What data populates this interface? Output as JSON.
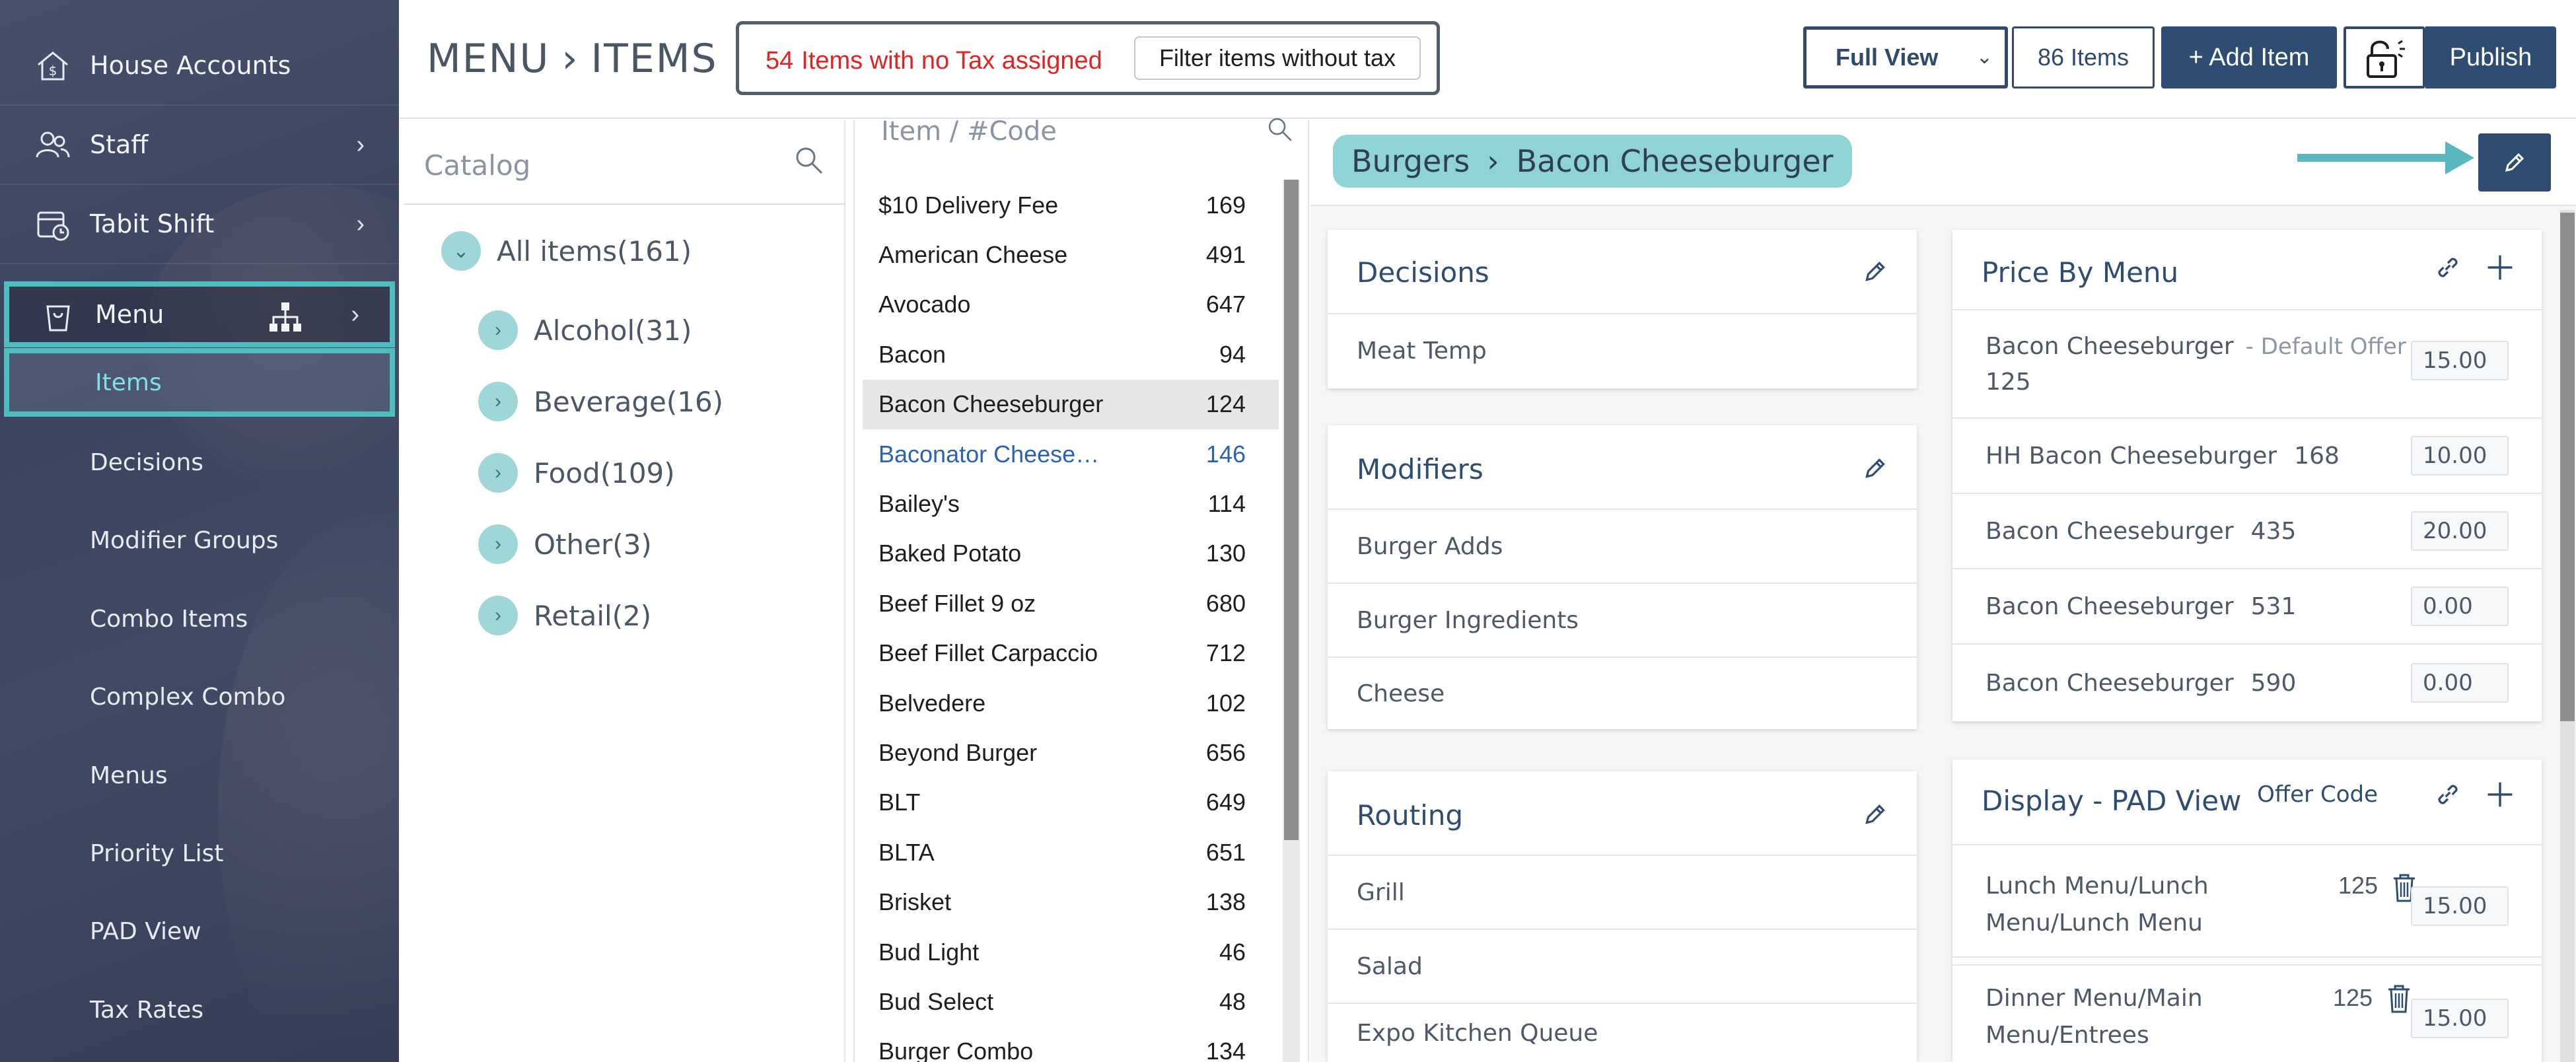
{
  "sidebar": {
    "items": [
      {
        "label": "House Accounts",
        "icon": "house-dollar-icon"
      },
      {
        "label": "Staff",
        "icon": "people-icon"
      },
      {
        "label": "Tabit Shift",
        "icon": "calendar-clock-icon"
      },
      {
        "label": "Menu",
        "icon": "menu-bag-icon"
      }
    ],
    "active_sub": "Items",
    "subitems": [
      "Decisions",
      "Modifier Groups",
      "Combo Items",
      "Complex Combo",
      "Menus",
      "Priority List",
      "PAD View",
      "Tax Rates"
    ],
    "highlight_color": "#4fbcc0"
  },
  "header": {
    "breadcrumb_root": "MENU",
    "breadcrumb_page": "ITEMS",
    "tax_alert_count": "54",
    "tax_alert_text": "Items with no Tax assigned",
    "filter_button": "Filter items without tax",
    "view_select": "Full View",
    "items_count": "86 Items",
    "add_item": "+ Add Item",
    "publish": "Publish"
  },
  "catalog": {
    "search_placeholder": "Catalog",
    "root": "All items(161)",
    "categories": [
      "Alcohol(31)",
      "Beverage(16)",
      "Food(109)",
      "Other(3)",
      "Retail(2)"
    ]
  },
  "items_list": {
    "search_placeholder": "Item / #Code",
    "rows": [
      {
        "name": "$10 Delivery Fee",
        "code": "169"
      },
      {
        "name": "American Cheese",
        "code": "491"
      },
      {
        "name": "Avocado",
        "code": "647"
      },
      {
        "name": "Bacon",
        "code": "94"
      },
      {
        "name": "Bacon Cheeseburger",
        "code": "124"
      },
      {
        "name": "Baconator Cheese…",
        "code": "146"
      },
      {
        "name": "Bailey's",
        "code": "114"
      },
      {
        "name": "Baked Potato",
        "code": "130"
      },
      {
        "name": "Beef Fillet 9 oz",
        "code": "680"
      },
      {
        "name": "Beef Fillet Carpaccio",
        "code": "712"
      },
      {
        "name": "Belvedere",
        "code": "102"
      },
      {
        "name": "Beyond Burger",
        "code": "656"
      },
      {
        "name": "BLT",
        "code": "649"
      },
      {
        "name": "BLTA",
        "code": "651"
      },
      {
        "name": "Brisket",
        "code": "138"
      },
      {
        "name": "Bud Light",
        "code": "46"
      },
      {
        "name": "Bud Select",
        "code": "48"
      },
      {
        "name": "Burger Combo",
        "code": "134"
      }
    ],
    "selected_index": 4,
    "link_index": 5
  },
  "detail": {
    "category": "Burgers",
    "item": "Bacon Cheeseburger",
    "accent_color": "#59b8bd",
    "decisions": {
      "title": "Decisions",
      "rows": [
        "Meat Temp"
      ]
    },
    "modifiers": {
      "title": "Modifiers",
      "rows": [
        "Burger Adds",
        "Burger Ingredients",
        "Cheese"
      ]
    },
    "routing": {
      "title": "Routing",
      "rows": [
        "Grill",
        "Salad",
        "Expo Kitchen Queue"
      ]
    },
    "price_by_menu": {
      "title": "Price By Menu",
      "rows": [
        {
          "name": "Bacon Cheeseburger",
          "note": "- Default Offer",
          "code": "125",
          "price": "15.00"
        },
        {
          "name": "HH Bacon Cheeseburger",
          "code": "168",
          "price": "10.00"
        },
        {
          "name": "Bacon Cheeseburger",
          "code": "435",
          "price": "20.00"
        },
        {
          "name": "Bacon Cheeseburger",
          "code": "531",
          "price": "0.00"
        },
        {
          "name": "Bacon Cheeseburger",
          "code": "590",
          "price": "0.00"
        }
      ]
    },
    "pad_view": {
      "title": "Display - PAD View",
      "offer_code_label": "Offer Code",
      "rows": [
        {
          "line1": "Lunch Menu/Lunch",
          "line2": "Menu/Lunch Menu",
          "code": "125",
          "price": "15.00"
        },
        {
          "line1": "Dinner Menu/Main",
          "line2": "Menu/Entrees",
          "code": "125",
          "price": "15.00"
        }
      ]
    }
  }
}
